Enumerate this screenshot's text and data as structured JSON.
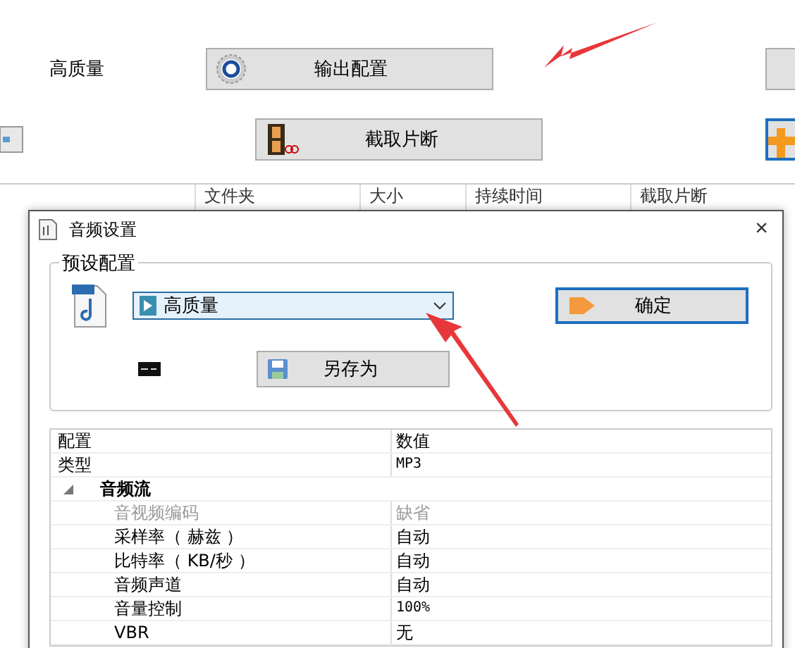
{
  "background_app": {
    "preset_label": "高质量",
    "buttons": [
      {
        "label": "输出配置",
        "kind": "gear"
      },
      {
        "label": "截取片断",
        "kind": "film"
      }
    ],
    "table": {
      "columns": [
        "文件夹",
        "大小",
        "持续时间",
        "截取片断"
      ]
    }
  },
  "dialog": {
    "title": "音频设置",
    "close": "×",
    "preset_group": {
      "title": "预设配置",
      "combo": {
        "value": "高质量"
      },
      "ok_button": "确定",
      "save_as_button": "另存为"
    },
    "grid": {
      "columns": [
        "配置",
        "数值"
      ],
      "rows": [
        {
          "kind": "row",
          "name": "类型",
          "value": "MP3",
          "disabled": false
        },
        {
          "kind": "category",
          "name": "音频流",
          "expanded": true,
          "children": [
            {
              "kind": "row",
              "name": "音视频编码",
              "value": "缺省",
              "disabled": true
            },
            {
              "kind": "row",
              "name": "采样率（ 赫兹 ）",
              "value": "自动",
              "disabled": false
            },
            {
              "kind": "row",
              "name": "比特率（ KB/秒 ）",
              "value": "自动",
              "disabled": false
            },
            {
              "kind": "row",
              "name": "音频声道",
              "value": "自动",
              "disabled": false
            },
            {
              "kind": "row",
              "name": "音量控制",
              "value": "100%",
              "disabled": false
            },
            {
              "kind": "row",
              "name": "VBR",
              "value": "无",
              "disabled": false
            }
          ]
        }
      ]
    }
  }
}
